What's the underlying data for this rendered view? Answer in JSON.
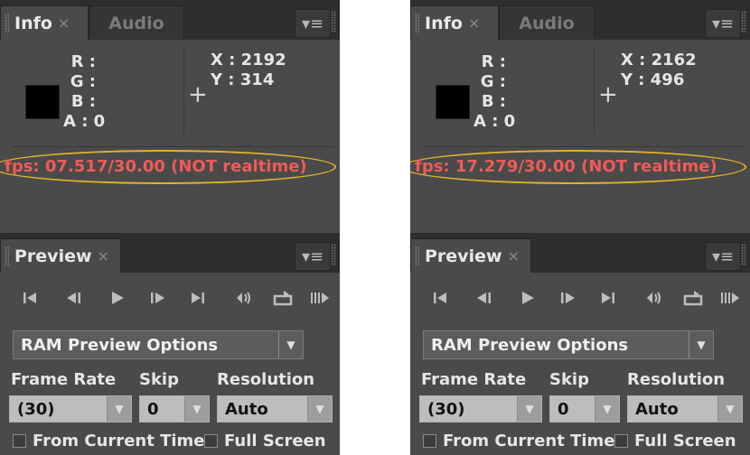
{
  "shots": [
    {
      "info": {
        "tab_label": "Info",
        "tab_close": "×",
        "second_tab_label": "Audio",
        "menu_icon": "▾≡",
        "r_label": "R :",
        "g_label": "G :",
        "b_label": "B :",
        "a_label": "A : 0",
        "x_label": "X : 2192",
        "y_label": "Y : 314",
        "crosshair": "+",
        "fps_text": "fps: 07.517/30.00 (NOT realtime)"
      },
      "preview": {
        "tab_label": "Preview",
        "tab_close": "×",
        "menu_icon": "▾≡",
        "ram_dropdown": "RAM Preview Options",
        "frame_rate_label": "Frame Rate",
        "skip_label": "Skip",
        "resolution_label": "Resolution",
        "frame_rate_value": "(30)",
        "skip_value": "0",
        "resolution_value": "Auto",
        "from_current_time": "From Current Time",
        "full_screen": "Full Screen"
      }
    },
    {
      "info": {
        "tab_label": "Info",
        "tab_close": "×",
        "second_tab_label": "Audio",
        "menu_icon": "▾≡",
        "r_label": "R :",
        "g_label": "G :",
        "b_label": "B :",
        "a_label": "A : 0",
        "x_label": "X : 2162",
        "y_label": "Y : 496",
        "crosshair": "+",
        "fps_text": "fps: 17.279/30.00 (NOT realtime)"
      },
      "preview": {
        "tab_label": "Preview",
        "tab_close": "×",
        "menu_icon": "▾≡",
        "ram_dropdown": "RAM Preview Options",
        "frame_rate_label": "Frame Rate",
        "skip_label": "Skip",
        "resolution_label": "Resolution",
        "frame_rate_value": "(30)",
        "skip_value": "0",
        "resolution_value": "Auto",
        "from_current_time": "From Current Time",
        "full_screen": "Full Screen"
      }
    }
  ],
  "transport_icons": [
    "first-frame-icon",
    "previous-frame-icon",
    "play-icon",
    "next-frame-icon",
    "last-frame-icon",
    "audio-icon",
    "loop-icon",
    "ram-preview-icon"
  ],
  "colors": {
    "fps_warning": "#ef5b58",
    "highlight_ellipse": "#e0b22a",
    "panel_bg": "#4a4a4a"
  }
}
